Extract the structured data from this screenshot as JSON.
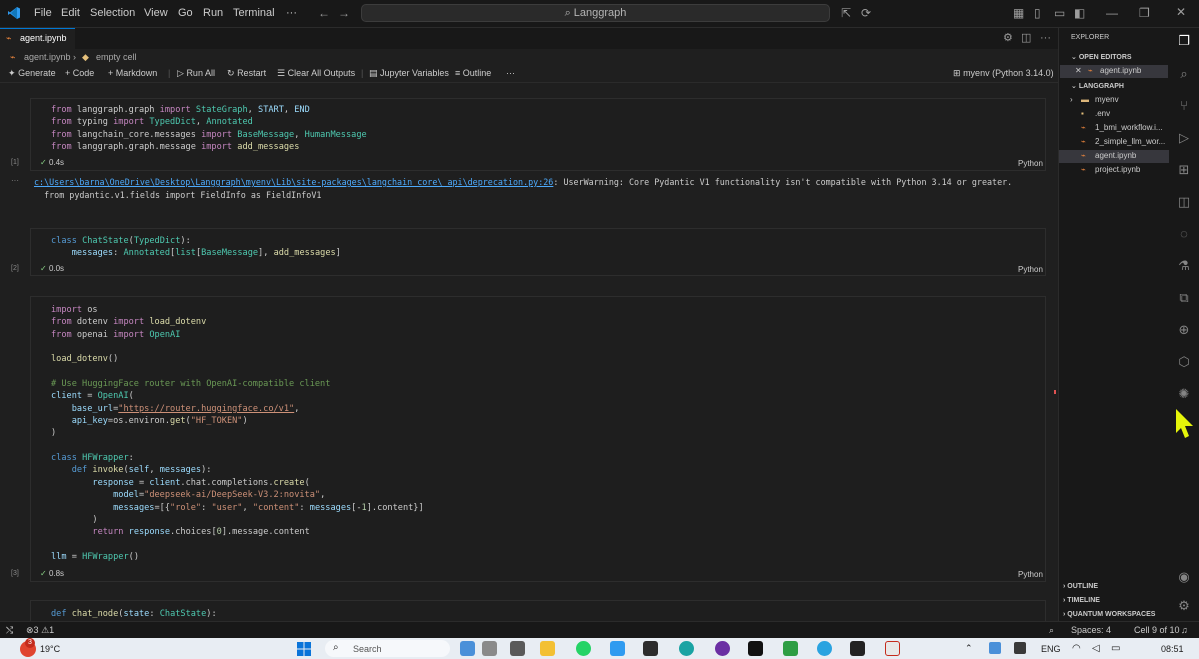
{
  "window": {
    "menu": [
      "File",
      "Edit",
      "Selection",
      "View",
      "Go",
      "Run",
      "Terminal",
      "···"
    ],
    "search_label": "Langgraph"
  },
  "tab": {
    "label": "agent.ipynb"
  },
  "breadcrumb": {
    "file": "agent.ipynb",
    "sep": "›",
    "cell": "empty cell"
  },
  "toolbar": {
    "generate": "Generate",
    "code": "Code",
    "markdown": "Markdown",
    "run_all": "Run All",
    "restart": "Restart",
    "clear": "Clear All Outputs",
    "variables": "Jupyter Variables",
    "outline": "Outline",
    "more": "···",
    "kernel": "myenv (Python 3.14.0)"
  },
  "cells": [
    {
      "exec": "[1]",
      "time": "0.4s",
      "lang": "Python"
    },
    {
      "exec": "[2]",
      "time": "0.0s",
      "lang": "Python"
    },
    {
      "exec": "[3]",
      "time": "0.8s",
      "lang": "Python"
    }
  ],
  "warning": {
    "path": "c:\\Users\\barna\\OneDrive\\Desktop\\Langgraph\\myenv\\Lib\\site-packages\\langchain_core\\_api\\deprecation.py:26",
    "message": ": UserWarning: Core Pydantic V1 functionality isn't compatible with Python 3.14 or greater.",
    "line2": "  from pydantic.v1.fields import FieldInfo as FieldInfoV1"
  },
  "sidebar": {
    "explorer": "EXPLORER",
    "open_editors": "OPEN EDITORS",
    "open_file": "agent.ipynb",
    "project": "LANGGRAPH",
    "files": [
      "myenv",
      ".env",
      "1_bmi_workflow.i...",
      "2_simple_llm_wor...",
      "agent.ipynb",
      "project.ipynb"
    ],
    "outline": "OUTLINE",
    "timeline": "TIMELINE",
    "quantum": "QUANTUM WORKSPACES"
  },
  "statusbar": {
    "errors": "3",
    "warnings": "1",
    "spaces": "Spaces: 4",
    "cell": "Cell 9 of 10"
  },
  "taskbar": {
    "badge": "3",
    "temp": "19°C",
    "search": "Search",
    "lang": "ENG",
    "time": "08:51"
  }
}
